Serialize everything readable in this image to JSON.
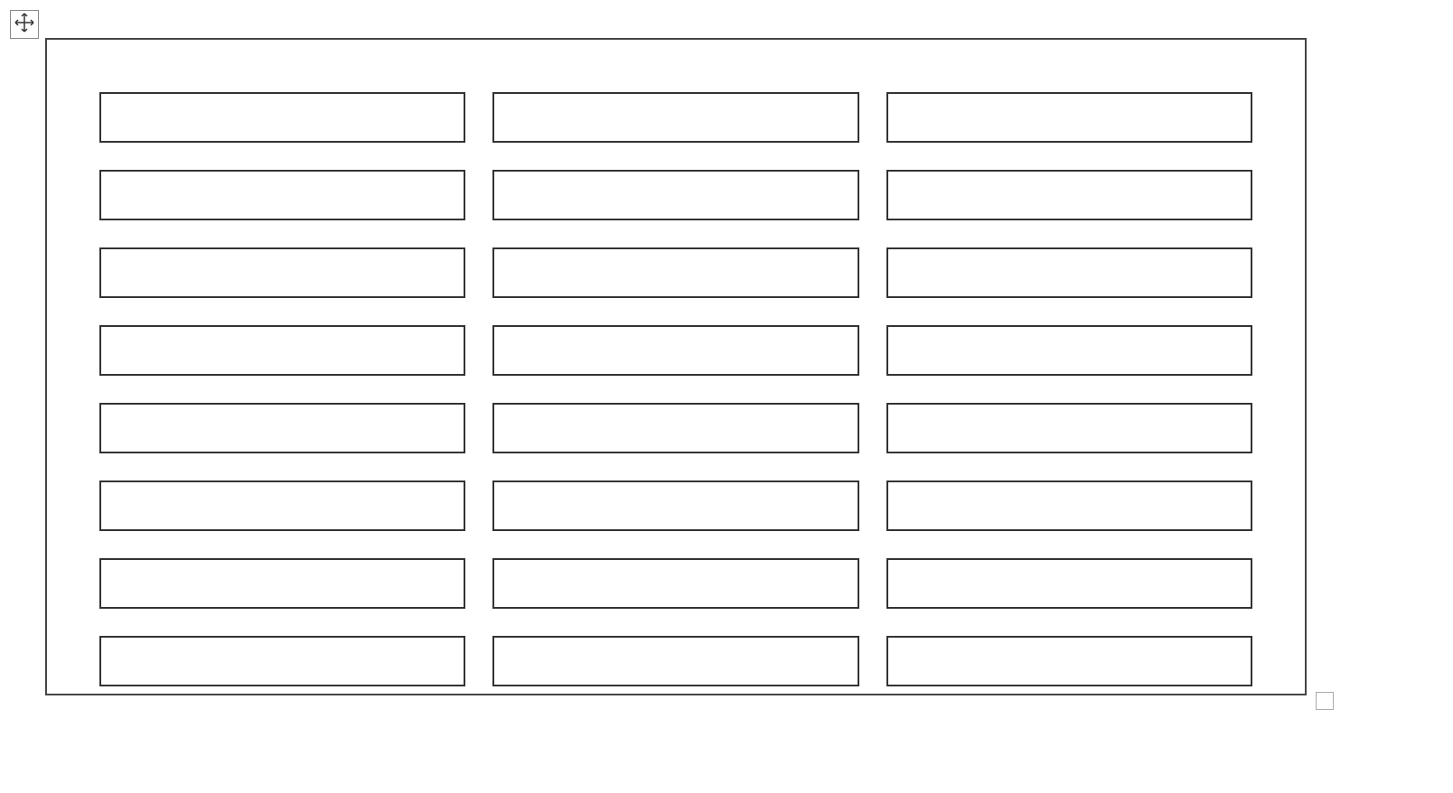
{
  "table": {
    "rows": 8,
    "cols": 3,
    "cells": [
      [
        "",
        "",
        ""
      ],
      [
        "",
        "",
        ""
      ],
      [
        "",
        "",
        ""
      ],
      [
        "",
        "",
        ""
      ],
      [
        "",
        "",
        ""
      ],
      [
        "",
        "",
        ""
      ],
      [
        "",
        "",
        ""
      ],
      [
        "",
        "",
        ""
      ]
    ]
  }
}
